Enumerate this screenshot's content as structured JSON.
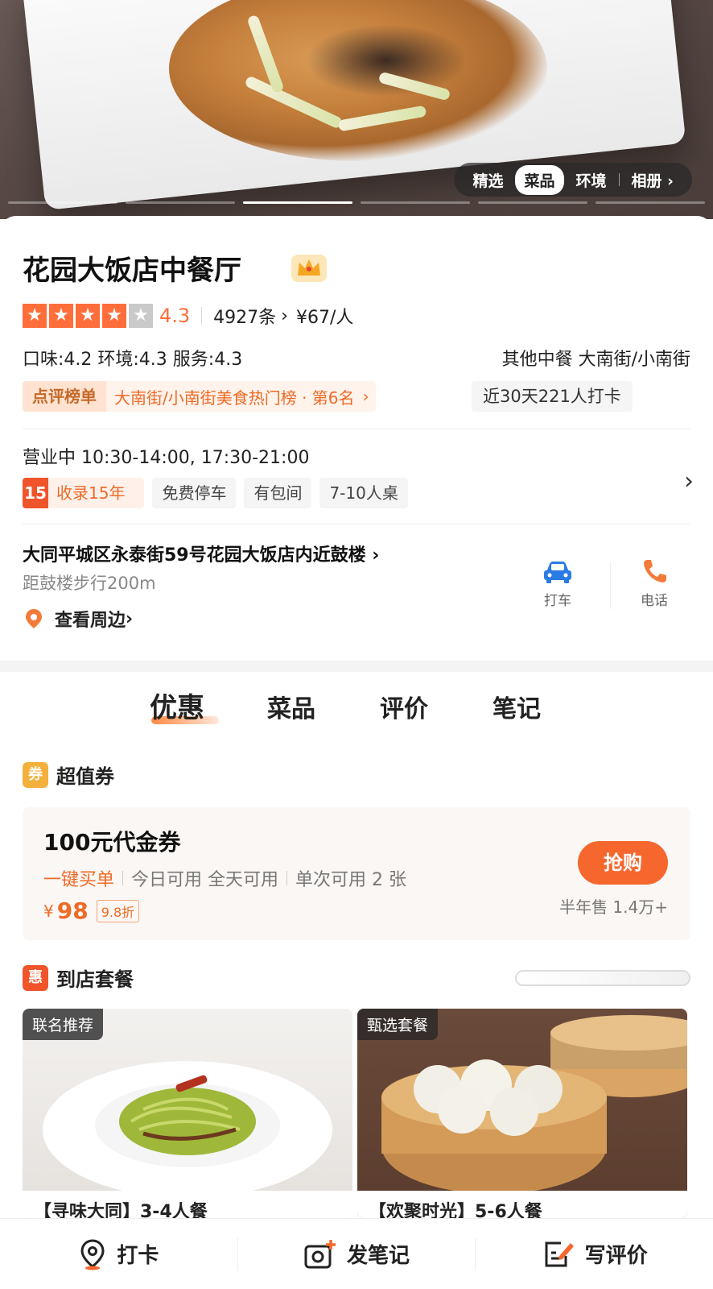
{
  "hero": {
    "tabs": [
      "精选",
      "菜品",
      "环境",
      "相册"
    ],
    "active_tab": "菜品",
    "slide_count": 6,
    "active_slide": 3
  },
  "shop": {
    "name": "花园大饭店中餐厅",
    "rating": "4.3",
    "stars_filled": 4,
    "reviews": "4927条",
    "price": "¥67/人",
    "sub_scores": "口味:4.2  环境:4.3  服务:4.3",
    "category_area": "其他中餐  大南街/小南街",
    "rank_tag": "点评榜单",
    "rank_text": "大南街/小南街美食热门榜 · 第6名",
    "checkin": "近30天221人打卡",
    "hours": "营业中  10:30-14:00, 17:30-21:00",
    "years_badge": "15",
    "years_text": "收录15年",
    "tags": [
      "免费停车",
      "有包间",
      "7-10人桌"
    ],
    "address": "大同平城区永泰街59号花园大饭店内近鼓楼",
    "distance": "距鼓楼步行200m",
    "nearby": "查看周边",
    "taxi_label": "打车",
    "phone_label": "电话"
  },
  "main_tabs": [
    "优惠",
    "菜品",
    "评价",
    "笔记"
  ],
  "voucher_section": {
    "icon": "券",
    "title": "超值券",
    "coupon": {
      "title": "100元代金券",
      "tag1": "一键买单",
      "tag2": "今日可用 全天可用",
      "tag3": "单次可用 2 张",
      "currency": "¥",
      "price": "98",
      "discount": "9.8折",
      "buy_label": "抢购",
      "sold": "半年售 1.4万+"
    }
  },
  "package_section": {
    "icon": "惠",
    "title": "到店套餐",
    "packages": [
      {
        "badge": "联名推荐",
        "title": "【寻味大同】3-4人餐"
      },
      {
        "badge": "甄选套餐",
        "title": "【欢聚时光】5-6人餐"
      }
    ]
  },
  "bottom_bar": {
    "checkin": "打卡",
    "note": "发笔记",
    "review": "写评价"
  },
  "colors": {
    "accent": "#f5672d",
    "star": "#ff6e3a",
    "voucher_icon": "#f4b03c",
    "package_icon": "#f0542a"
  }
}
